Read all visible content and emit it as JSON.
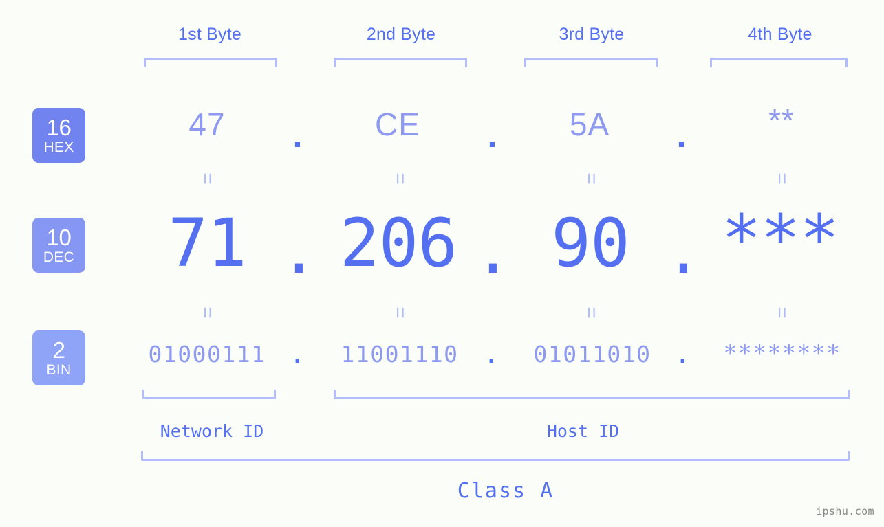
{
  "background": "#fbfdf8",
  "accent": {
    "strong_blue": "#5470f0",
    "light_blue": "#8e99f0",
    "bracket": "#b3bdfb",
    "badge_hex": "#7083ee",
    "badge_dec": "#8596f3",
    "badge_bin": "#8fa3f7",
    "watermark": "#8a8a8a"
  },
  "byte_headers": [
    {
      "label": "1st Byte"
    },
    {
      "label": "2nd Byte"
    },
    {
      "label": "3rd Byte"
    },
    {
      "label": "4th Byte"
    }
  ],
  "bases": [
    {
      "number": "16",
      "abbr": "HEX"
    },
    {
      "number": "10",
      "abbr": "DEC"
    },
    {
      "number": "2",
      "abbr": "BIN"
    }
  ],
  "separator": ".",
  "equals": "=",
  "rows": {
    "hex": {
      "base": "16",
      "abbr": "HEX",
      "values": [
        "47",
        "CE",
        "5A",
        "**"
      ]
    },
    "dec": {
      "base": "10",
      "abbr": "DEC",
      "values": [
        "71",
        "206",
        "90",
        "***"
      ]
    },
    "bin": {
      "base": "2",
      "abbr": "BIN",
      "values": [
        "01000111",
        "11001110",
        "01011010",
        "********"
      ]
    }
  },
  "regions": {
    "network_id": "Network ID",
    "host_id": "Host ID",
    "class": "Class A"
  },
  "watermark": "ipshu.com"
}
